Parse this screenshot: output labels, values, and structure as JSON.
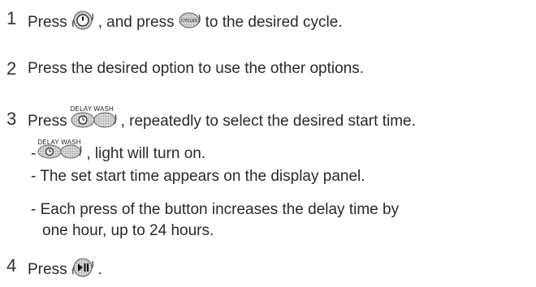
{
  "steps": [
    {
      "number": "1",
      "parts": [
        "Press",
        ", and press",
        "to the desired cycle."
      ],
      "icons": [
        "power-button-icon",
        "cycles-button-icon"
      ],
      "cycles_label": "CYCLES"
    },
    {
      "number": "2",
      "text": "Press the desired option to use the other options."
    },
    {
      "number": "3",
      "parts": [
        "Press",
        ", repeatedly to select the desired start time."
      ],
      "icons": [
        "delay-wash-button-icon"
      ],
      "delay_wash_label": "DELAY WASH",
      "subitems": [
        {
          "prefix": "-",
          "text": ", light will turn on.",
          "icon": "delay-wash-button-icon",
          "icon_label": "DELAY WASH"
        },
        {
          "text": "- The set start time appears on the display panel."
        },
        {
          "text": "- Each press of the button increases the delay time by"
        },
        {
          "text": "one hour, up to 24 hours."
        }
      ]
    },
    {
      "number": "4",
      "parts": [
        "Press",
        "."
      ],
      "icons": [
        "start-pause-button-icon"
      ]
    }
  ]
}
